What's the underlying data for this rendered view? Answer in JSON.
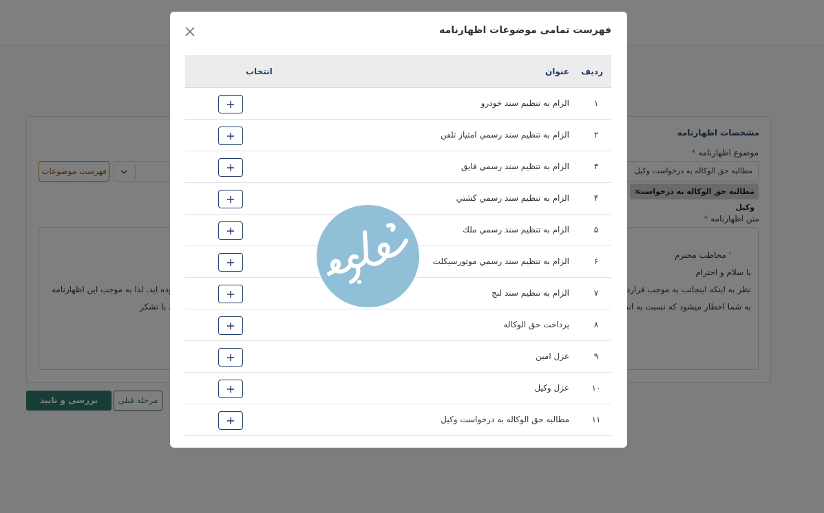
{
  "background": {
    "section_title": "مشخصات اظهارنامه",
    "subject_label": "موضوع اظهارنامه",
    "required_mark": "*",
    "subject_value": "مطالبه حق الوکاله به درخواست وکیل",
    "tag_label": "مطالبه حق الوکاله به درخواست وکیل",
    "tag_remove": "×",
    "topics_button": "فهرست موضوعات",
    "text_label": "متن اظهارنامه",
    "text_lines": [
      "' مخاطب محترم",
      "با سلام و احترام",
      "نظر به اینکه اینجانب به موجب قرارداد و",
      "نموده اید. لذا به موجب این اظهارنامه",
      "به شما اخطار میشود که نسبت به انجام",
      ". با تشکر"
    ],
    "confirm_button": "بررسی و تایید اطلاعات",
    "prev_button": "مرحله قبلی"
  },
  "modal": {
    "title": "فهرست تمامی موضوعات اظهارنامه",
    "columns": {
      "row": "ردیف",
      "title": "عنوان",
      "select": "انتخاب"
    },
    "rows": [
      {
        "num": "۱",
        "title": "الزام به تنظیم سند خودرو"
      },
      {
        "num": "۲",
        "title": "الزام به تنظيم سند رسمي امتياز تلفن"
      },
      {
        "num": "۳",
        "title": "الزام به تنظيم سند رسمي قايق"
      },
      {
        "num": "۴",
        "title": "الزام به تنظيم سند رسمي كشتي"
      },
      {
        "num": "۵",
        "title": "الزام به تنظيم سند رسمي ملك"
      },
      {
        "num": "۶",
        "title": "الزام به تنظيم سند رسمي موتورسيكلت"
      },
      {
        "num": "۷",
        "title": "الزام به تنظیم سند لنج"
      },
      {
        "num": "۸",
        "title": "پرداخت حق الوکاله"
      },
      {
        "num": "۹",
        "title": "عزل امین"
      },
      {
        "num": "۱۰",
        "title": "عزل وکیل"
      },
      {
        "num": "۱۱",
        "title": "مطالبه حق الوکاله به درخواست وکیل"
      }
    ]
  },
  "icons": {
    "close": "close-icon",
    "add": "plus-icon",
    "chevron": "chevron-down-icon"
  },
  "colors": {
    "primary": "#2e7d6c",
    "accent_navy": "#1f3d6b",
    "orange": "#c0761f",
    "logo_blue": "#8bbcd6"
  }
}
